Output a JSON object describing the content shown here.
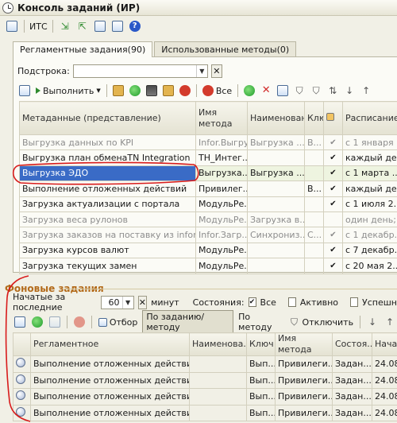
{
  "window": {
    "title": "Консоль заданий (ИР)"
  },
  "main_toolbar": {
    "its_label": "ИТС"
  },
  "tabs": [
    {
      "label": "Регламентные задания(90)",
      "active": true
    },
    {
      "label": "Использованные методы(0)",
      "active": false
    }
  ],
  "filter": {
    "label": "Подстрока:",
    "value": ""
  },
  "task_toolbar": {
    "run_label": "Выполнить",
    "all_label": "Все"
  },
  "task_table": {
    "headers": [
      "Метаданные (представление)",
      "Имя метода",
      "Наименование",
      "Ключ",
      "",
      "Расписание"
    ],
    "rows": [
      {
        "name": "Выгрузка данных по KPI",
        "method": "Infor.Выгру...",
        "title": "Выгрузка ...",
        "key": "В...",
        "use": "✔",
        "schedule": "с 1 января ...",
        "gray": true,
        "selected": false
      },
      {
        "name": "Выгрузка план обменаTN  Integration",
        "method": "TH_Интег...",
        "title": "",
        "key": "",
        "use": "✔",
        "schedule": "каждый де...",
        "gray": false,
        "selected": false
      },
      {
        "name": "Выгрузка ЭДО",
        "method": "Выгрузка...",
        "title": "Выгрузка ...",
        "key": "",
        "use": "✔",
        "schedule": "с 1 марта ...",
        "gray": false,
        "selected": true
      },
      {
        "name": "Выполнение отложенных действий",
        "method": "Привилег...",
        "title": "",
        "key": "В...",
        "use": "✔",
        "schedule": "каждый де...",
        "gray": false,
        "selected": false
      },
      {
        "name": "Загрузка актуализации с портала",
        "method": "МодульРе...",
        "title": "",
        "key": "",
        "use": "✔",
        "schedule": "с 1 июля 2...",
        "gray": false,
        "selected": false
      },
      {
        "name": "Загрузка веса рулонов",
        "method": "МодульРе...",
        "title": "Загрузка в...",
        "key": "",
        "use": "",
        "schedule": "один день; ...",
        "gray": true,
        "selected": false
      },
      {
        "name": "Загрузка заказов на поставку из infor",
        "method": "Infor.Загр...",
        "title": "Синхрониз...",
        "key": "С...",
        "use": "✔",
        "schedule": "с 1 декабр...",
        "gray": true,
        "selected": false
      },
      {
        "name": "Загрузка курсов валют",
        "method": "МодульРе...",
        "title": "",
        "key": "",
        "use": "✔",
        "schedule": "с 7 декабр...",
        "gray": false,
        "selected": false
      },
      {
        "name": "Загрузка текущих замен",
        "method": "МодульРе...",
        "title": "",
        "key": "",
        "use": "✔",
        "schedule": "с 20 мая 2...",
        "gray": false,
        "selected": false
      }
    ]
  },
  "background": {
    "title": "Фоновые задания",
    "started_label": "Начатые за последние",
    "minutes_value": "60",
    "minutes_unit": "минут",
    "state_label": "Состояния:",
    "states": [
      {
        "label": "Все",
        "checked": true
      },
      {
        "label": "Активно",
        "checked": false
      },
      {
        "label": "Успешн",
        "checked": false
      }
    ],
    "toolbar": {
      "selection_label": "Отбор",
      "by_task_label": "По заданию/методу",
      "by_method_label": "По методу",
      "disable_label": "Отключить"
    },
    "headers": [
      "",
      "Регламентное",
      "Наименова...",
      "Ключ",
      "Имя метода",
      "Состоя...",
      "Нача"
    ],
    "rows": [
      {
        "task": "Выполнение отложенных действий",
        "name": "",
        "key": "Вып...",
        "method": "Привилеги...",
        "state": "Задан...",
        "start": "24.08"
      },
      {
        "task": "Выполнение отложенных действий",
        "name": "",
        "key": "Вып...",
        "method": "Привилеги...",
        "state": "Задан...",
        "start": "24.08"
      },
      {
        "task": "Выполнение отложенных действий",
        "name": "",
        "key": "Вып...",
        "method": "Привилеги...",
        "state": "Задан...",
        "start": "24.08"
      },
      {
        "task": "Выполнение отложенных действий",
        "name": "",
        "key": "Вып...",
        "method": "Привилеги...",
        "state": "Задан...",
        "start": "24.08"
      }
    ]
  },
  "colors": {
    "selection": "#3a6bc6",
    "section_title": "#b36b1b",
    "annotation": "#d81b1b"
  }
}
